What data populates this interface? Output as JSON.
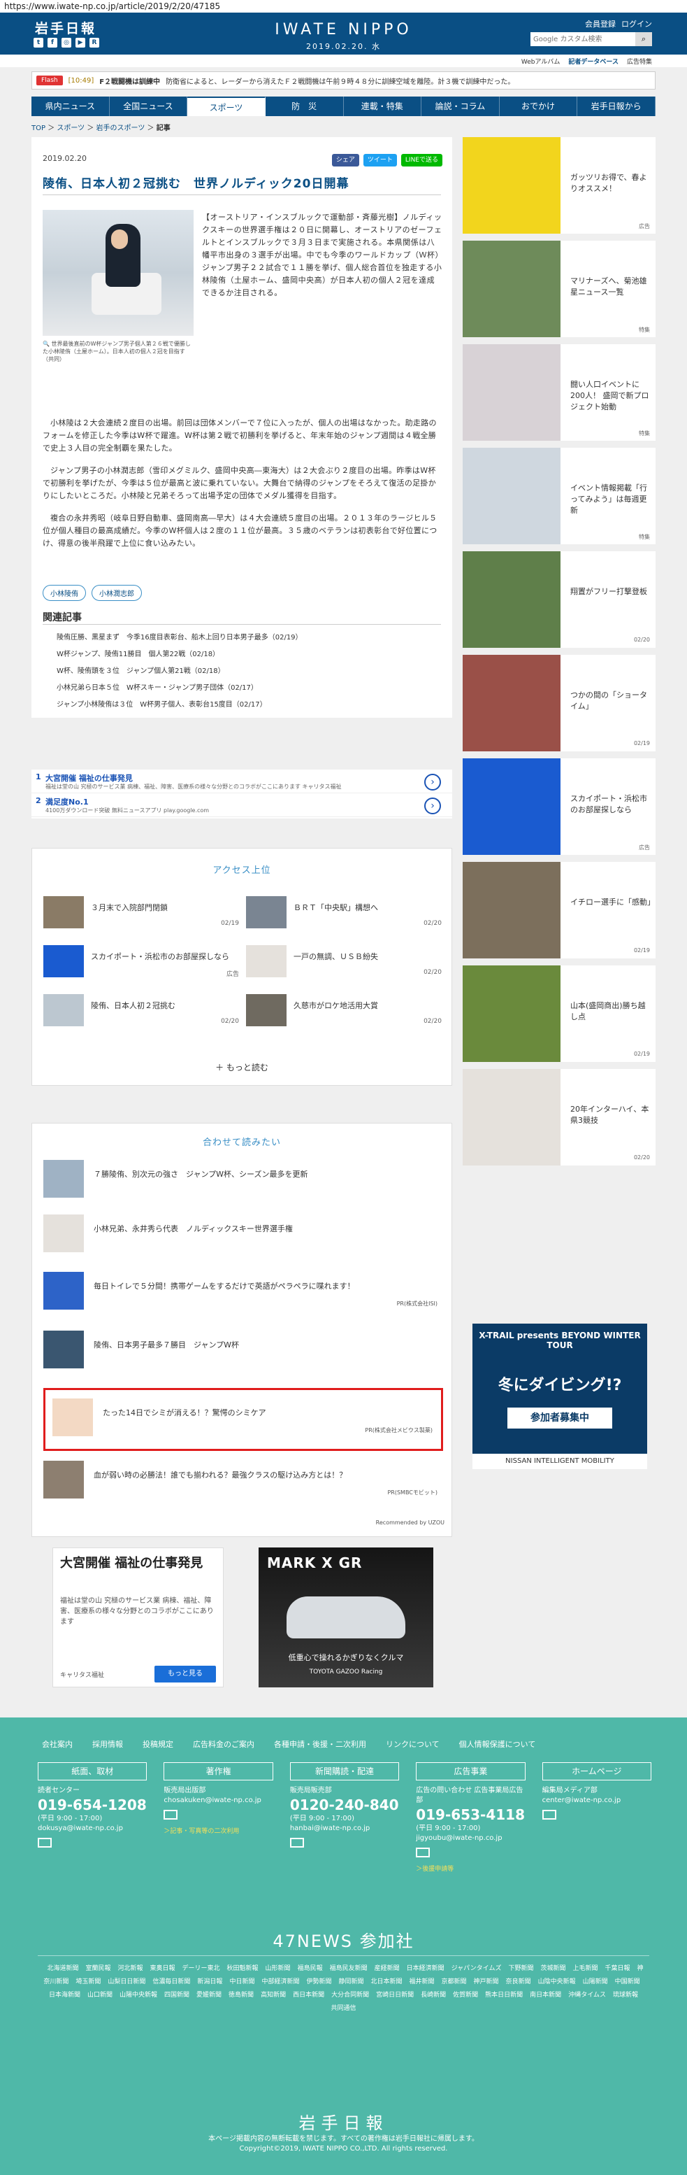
{
  "url": "https://www.iwate-np.co.jp/article/2019/2/20/47185",
  "header": {
    "logo": "岩手日報",
    "brand": "IWATE NIPPO",
    "date": "2019.02.20. 水",
    "links": [
      "会員登録",
      "ログイン"
    ],
    "search_placeholder": "Google カスタム検索",
    "search_icon": "search-icon",
    "social": [
      "twitter-icon",
      "facebook-icon",
      "instagram-icon",
      "youtube-icon",
      "rss-icon"
    ]
  },
  "subnav": {
    "links": [
      "Webアルバム",
      "記者データベース",
      "広告特集"
    ]
  },
  "flash": {
    "tag": "Flash",
    "time": "[10:49]",
    "text": "F２戦闘機は訓練中",
    "detail": "防衛省によると、レーダーから消えたＦ２戦闘機は午前９時４８分に訓練空域を離陸。計３機で訓練中だった。"
  },
  "gnav": [
    "県内ニュース",
    "全国ニュース",
    "スポーツ",
    "防　災",
    "連載・特集",
    "論説・コラム",
    "おでかけ",
    "岩手日報から"
  ],
  "breadcrumb": [
    "TOP",
    "スポーツ",
    "岩手のスポーツ",
    "記事"
  ],
  "article": {
    "date": "2019.02.20",
    "share": [
      "シェア",
      "ツイート",
      "LINEで送る"
    ],
    "title": "陵侑、日本人初２冠挑む　世界ノルディック20日開幕",
    "caption": "世界最後直前のW杯ジャンプ男子個人第２６戦で優勝した小林陵侑（土屋ホーム）。日本人初の個人２冠を目指す（共同）",
    "lead": "【オーストリア・インスブルックで運動部・斉藤光樹】ノルディックスキーの世界選手権は２０日に開幕し、オーストリアのゼーフェルトとインスブルックで３月３日まで実施される。本県関係は八幡平市出身の３選手が出場。中でも今季のワールドカップ（Ｗ杯）ジャンプ男子２２試合で１１勝を挙げ、個人総合首位を独走する小林陵侑（土屋ホーム、盛岡中央高）が日本人初の個人２冠を達成できるか注目される。",
    "paragraphs": [
      "小林陵は２大会連続２度目の出場。前回は団体メンバーで７位に入ったが、個人の出場はなかった。助走路のフォームを修正した今季はW杯で躍進。W杯は第２戦で初勝利を挙げると、年末年始のジャンプ週間は４戦全勝で史上３人目の完全制覇を果たした。",
      "ジャンプ男子の小林潤志郎（雪印メグミルク、盛岡中央高―東海大）は２大会ぶり２度目の出場。昨季はW杯で初勝利を挙げたが、今季は５位が最高と波に乗れていない。大舞台で納得のジャンプをそろえて復活の足掛かりにしたいところだ。小林陵と兄弟そろって出場予定の団体でメダル獲得を目指す。",
      "複合の永井秀昭（岐阜日野自動車、盛岡南高―早大）は４大会連続５度目の出場。２０１３年のラージヒル５位が個人種目の最高成績だ。今季のW杯個人は２度の１１位が最高。３５歳のベテランは初表彰台で好位置につけ、得意の後半飛躍で上位に食い込みたい。"
    ],
    "tags": [
      "小林陵侑",
      "小林潤志郎"
    ],
    "related_title": "関連記事",
    "related": [
      "陵侑圧勝、黒星まず　今季16度目表彰台、船木上回り日本男子最多（02/19）",
      "W杯ジャンプ、陵侑11勝目　個人第22戦（02/18）",
      "W杯、陵侑頭を３位　ジャンプ個人第21戦（02/18）",
      "小林兄弟ら日本５位　W杯スキー・ジャンプ男子団体（02/17）",
      "ジャンプ小林陵侑は３位　W杯男子個人、表彰台15度目（02/17）"
    ]
  },
  "ad_list": [
    {
      "num": "1",
      "title": "大宮開催 福祉の仕事発見",
      "desc": "福祉は堂の山 究極のサービス業 病棟、福祉、障害、医療系の様々な分野とのコラボがここにあります キャリタス福祉"
    },
    {
      "num": "2",
      "title": "満足度No.1",
      "desc": "4100万ダウンロード突破 無料ニュースアプリ play.google.com"
    }
  ],
  "ranking": {
    "title": "アクセス上位",
    "items": [
      {
        "text": "３月末で入院部門閉鎖",
        "date": "02/19"
      },
      {
        "text": "ＢＲＴ「中央駅」構想へ",
        "date": "02/20"
      },
      {
        "text": "スカイポート・浜松市のお部屋探しなら",
        "date": "広告"
      },
      {
        "text": "一戸の無調、ＵＳＢ紛失",
        "date": "02/20"
      },
      {
        "text": "陵侑、日本人初２冠挑む",
        "date": "02/20"
      },
      {
        "text": "久慈市がロケ地活用大賞",
        "date": "02/20"
      }
    ],
    "more": "＋ もっと読む"
  },
  "recommend": {
    "title": "合わせて読みたい",
    "items": [
      {
        "text": "７勝陵侑、別次元の強さ　ジャンプW杯、シーズン最多を更新",
        "pr": ""
      },
      {
        "text": "小林兄弟、永井秀ら代表　ノルディックスキー世界選手権",
        "pr": ""
      },
      {
        "text": "毎日トイレで５分間！携帯ゲームをするだけで英語がペラペラに喋れます！",
        "pr": "PR(株式会社ISI)"
      },
      {
        "text": "陵侑、日本男子最多７勝目　ジャンプW杯",
        "pr": ""
      },
      {
        "text": "たった14日でシミが消える！？驚愕のシミケア",
        "pr": "PR(株式会社メビウス製薬)"
      },
      {
        "text": "血が弱い時の必勝法！誰でも揃われる？最強クラスの駆け込み方とは！？",
        "pr": "PR(SMBCモビット)"
      }
    ],
    "by": "Recommended by UZOU"
  },
  "ad_fukushi": {
    "title": "大宮開催 福祉の仕事発見",
    "desc": "福祉は堂の山 究極のサービス業 病棟、福祉、障害、医療系の様々な分野とのコラボがここにあります",
    "src": "キャリタス福祉",
    "btn": "もっと見る"
  },
  "ad_car": {
    "title": "MARK X GR",
    "copy": "低重心で操れるかぎりなくクルマ",
    "brand": "TOYOTA GAZOO Racing"
  },
  "sidebar": [
    {
      "text": "ガッツリお得で、春よりオススメ！",
      "date": "広告"
    },
    {
      "text": "マリナーズへ、菊池雄星ニュース一覧",
      "date": "特集"
    },
    {
      "text": "闘い人口イベントに200人！ 盛岡で新プロジェクト始動",
      "date": "特集"
    },
    {
      "text": "イベント情報掲載「行ってみよう」は毎週更新",
      "date": "特集"
    },
    {
      "text": "翔置がフリー打撃登板",
      "date": "02/20"
    },
    {
      "text": "つかの間の「ショータイム」",
      "date": "02/19"
    },
    {
      "text": "スカイポート・浜松市のお部屋探しなら",
      "date": "広告"
    },
    {
      "text": "イチロー選手に「感動」",
      "date": "02/19"
    },
    {
      "text": "山本(盛岡商出)勝ち越し点",
      "date": "02/19"
    },
    {
      "text": "20年インターハイ、本県3競技",
      "date": "02/20"
    }
  ],
  "side_ad": {
    "t1": "X-TRAIL presents BEYOND WINTER TOUR",
    "t2": "冬にダイビング!?",
    "t3": "参加者募集中",
    "t4": "NISSAN INTELLIGENT MOBILITY"
  },
  "footer": {
    "links": [
      "会社案内",
      "採用情報",
      "投稿規定",
      "広告料金のご案内",
      "各種申請・後援・二次利用",
      "リンクについて",
      "個人情報保護について"
    ],
    "cols": [
      {
        "h": "紙面、取材",
        "l1": "読者センター",
        "big": "019-654-1208",
        "hours": "(平日 9:00 - 17:00)",
        "mail": "dokusya@iwate-np.co.jp",
        "extra": ""
      },
      {
        "h": "著作権",
        "l1": "販売局出版部",
        "big": "",
        "hours": "",
        "mail": "chosakuken@iwate-np.co.jp",
        "extra": "＞記事・写真等の二次利用"
      },
      {
        "h": "新聞購読・配達",
        "l1": "販売局販売部",
        "big": "0120-240-840",
        "hours": "(平日 9:00 - 17:00)",
        "mail": "hanbai@iwate-np.co.jp",
        "extra": ""
      },
      {
        "h": "広告事業",
        "l1": "広告の問い合わせ 広告事業局広告部",
        "big": "019-653-4118",
        "hours": "(平日 9:00 - 17:00)",
        "mail": "jigyoubu@iwate-np.co.jp",
        "extra": "＞後援申請等"
      },
      {
        "h": "ホームページ",
        "l1": "編集局メディア部",
        "big": "",
        "hours": "",
        "mail": "center@iwate-np.co.jp",
        "extra": ""
      }
    ],
    "news_title": "47NEWS 参加社",
    "news": [
      "北海道新聞",
      "室蘭民報",
      "河北新報",
      "東奥日報",
      "デーリー東北",
      "秋田魁新報",
      "山形新聞",
      "福島民報",
      "福島民友新聞",
      "産経新聞",
      "日本経済新聞",
      "ジャパンタイムズ",
      "下野新聞",
      "茨城新聞",
      "上毛新聞",
      "千葉日報",
      "神奈川新聞",
      "埼玉新聞",
      "山梨日日新聞",
      "信濃毎日新聞",
      "新潟日報",
      "中日新聞",
      "中部経済新聞",
      "伊勢新聞",
      "静岡新聞",
      "北日本新聞",
      "福井新聞",
      "京都新聞",
      "神戸新聞",
      "奈良新聞",
      "山陰中央新報",
      "山陽新聞",
      "中国新聞",
      "日本海新聞",
      "山口新聞",
      "山陽中央新報",
      "四国新聞",
      "愛媛新聞",
      "徳島新聞",
      "高知新聞",
      "西日本新聞",
      "大分合同新聞",
      "宮崎日日新聞",
      "長崎新聞",
      "佐賀新聞",
      "熊本日日新聞",
      "南日本新聞",
      "沖縄タイムス",
      "琉球新報",
      "共同通信"
    ],
    "logo": "岩手日報",
    "copy1": "本ページ掲載内容の無断転載を禁じます。すべての著作権は岩手日報社に帰属します。",
    "copy2": "Copyright©2019, IWATE NIPPO CO.,LTD. All rights reserved."
  }
}
